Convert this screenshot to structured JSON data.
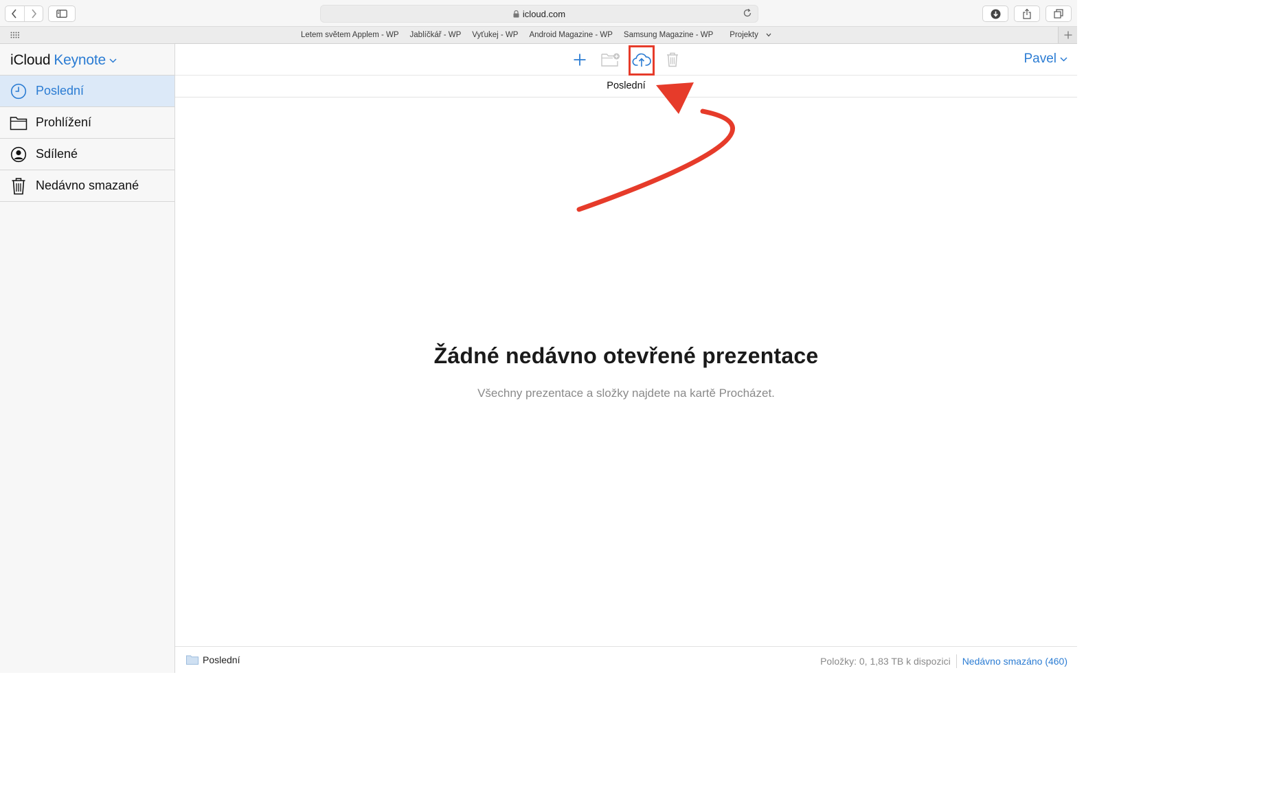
{
  "browser": {
    "address": "icloud.com",
    "favorites": [
      "Letem světem Applem - WP",
      "Jablíčkář - WP",
      "Vyťukej - WP",
      "Android Magazine - WP",
      "Samsung Magazine - WP",
      "Projekty"
    ]
  },
  "app": {
    "brand_prefix": "iCloud",
    "brand_app": "Keynote"
  },
  "sidebar": {
    "items": [
      {
        "label": "Poslední",
        "icon": "clock-icon",
        "active": true
      },
      {
        "label": "Prohlížení",
        "icon": "folder-icon",
        "active": false
      },
      {
        "label": "Sdílené",
        "icon": "person-circle-icon",
        "active": false
      },
      {
        "label": "Nedávno smazané",
        "icon": "trash-icon",
        "active": false
      }
    ]
  },
  "toolbar": {
    "user": "Pavel",
    "icons": [
      "plus-icon",
      "new-folder-icon",
      "upload-cloud-icon",
      "trash-icon"
    ]
  },
  "main": {
    "section_title": "Poslední",
    "empty_title": "Žádné nedávno otevřené prezentace",
    "empty_subtitle": "Všechny prezentace a složky najdete na kartě Procházet."
  },
  "status": {
    "location": "Poslední",
    "items_info": "Položky: 0, 1,83 TB k dispozici",
    "recently_deleted_link": "Nedávno smazáno (460)"
  },
  "colors": {
    "accent": "#2b7cd3",
    "highlight": "#e63b2a",
    "active_row": "#dce9f8"
  }
}
